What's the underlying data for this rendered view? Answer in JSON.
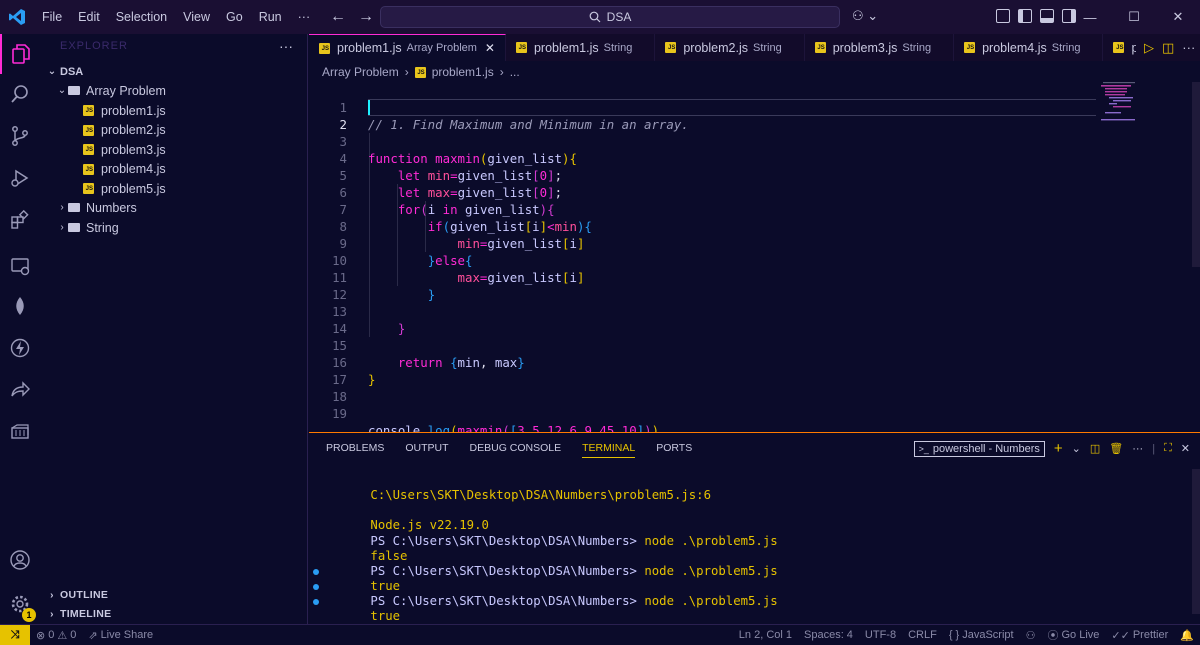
{
  "titlebar": {
    "menus": [
      "File",
      "Edit",
      "Selection",
      "View",
      "Go",
      "Run",
      "···"
    ],
    "search_text": "DSA"
  },
  "sidebar": {
    "header": "EXPLORER",
    "root": "DSA",
    "folder_open": "Array Problem",
    "files": [
      "problem1.js",
      "problem2.js",
      "problem3.js",
      "problem4.js",
      "problem5.js"
    ],
    "folders_closed": [
      "Numbers",
      "String"
    ],
    "outline_label": "OUTLINE",
    "timeline_label": "TIMELINE",
    "settings_badge": "1"
  },
  "tabs": [
    {
      "name": "problem1.js",
      "desc": "Array Problem",
      "active": true
    },
    {
      "name": "problem1.js",
      "desc": "String",
      "active": false
    },
    {
      "name": "problem2.js",
      "desc": "String",
      "active": false
    },
    {
      "name": "problem3.js",
      "desc": "String",
      "active": false
    },
    {
      "name": "problem4.js",
      "desc": "String",
      "active": false
    },
    {
      "name": "probl",
      "desc": "",
      "active": false
    }
  ],
  "breadcrumb": {
    "folder": "Array Problem",
    "file": "problem1.js",
    "tail": "..."
  },
  "code": {
    "line_numbers": [
      "1",
      "2",
      "3",
      "4",
      "5",
      "6",
      "7",
      "8",
      "9",
      "10",
      "11",
      "12",
      "13",
      "14",
      "15",
      "16",
      "17",
      "18",
      "19"
    ],
    "current_line": "2",
    "l1": "// 1. Find Maximum and Minimum in an array.",
    "fn_kw": "function",
    "fn_name": "maxmin",
    "fn_param": "given_list",
    "let_kw": "let",
    "min_var": "min",
    "max_var": "max",
    "arr": "given_list",
    "zero": "0",
    "for_kw": "for",
    "i_var": "i",
    "in_kw": "in",
    "if_kw": "if",
    "else_kw": "else",
    "return_kw": "return",
    "console": "console",
    "log": "log",
    "args": [
      "3",
      "5",
      "12",
      "6",
      "9",
      "45",
      "10"
    ]
  },
  "panel": {
    "tabs": [
      "PROBLEMS",
      "OUTPUT",
      "DEBUG CONSOLE",
      "TERMINAL",
      "PORTS"
    ],
    "active_tab": "TERMINAL",
    "shell": "powershell - Numbers",
    "lines": {
      "err_path": "C:\\Users\\SKT\\Desktop\\DSA\\Numbers\\problem5.js:6",
      "node_ver": "Node.js v22.19.0",
      "prompt": "PS C:\\Users\\SKT\\Desktop\\DSA\\Numbers>",
      "cmd": "node .\\problem5.js",
      "out1": "false",
      "out2": "true",
      "out3": "true"
    }
  },
  "statusbar": {
    "errors": "0",
    "warnings": "0",
    "live_share": "Live Share",
    "position": "Ln 2, Col 1",
    "spaces": "Spaces: 4",
    "encoding": "UTF-8",
    "eol": "CRLF",
    "language": "JavaScript",
    "go_live": "Go Live",
    "prettier": "Prettier"
  }
}
